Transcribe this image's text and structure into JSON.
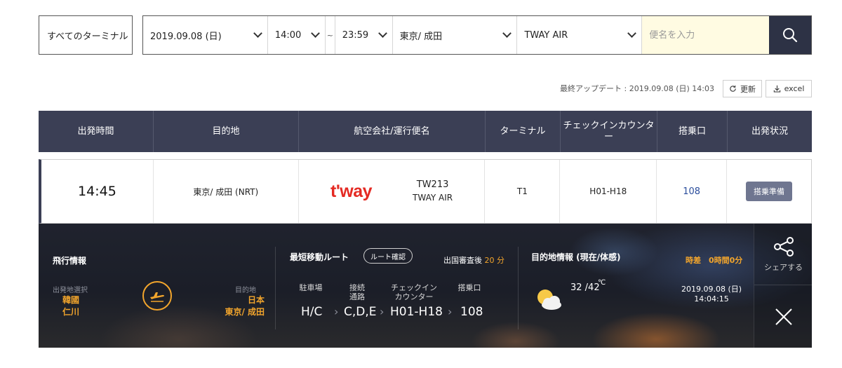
{
  "search": {
    "terminal": "すべてのターミナル",
    "date": "2019.09.08 (日)",
    "time_from": "14:00",
    "tilde": "~",
    "time_to": "23:59",
    "destination": "東京/ 成田",
    "airline": "TWAY AIR",
    "flight_placeholder": "便名を入力",
    "flight_value": ""
  },
  "update": {
    "text": "最終アップデート : 2019.09.08 (日) 14:03",
    "refresh_label": "更新",
    "excel_label": "excel"
  },
  "table": {
    "headers": [
      "出発時間",
      "目的地",
      "航空会社/運行便名",
      "ターミナル",
      "チェックインカウンター",
      "搭乗口",
      "出発状況"
    ],
    "row": {
      "time": "14:45",
      "destination": "東京/ 成田 (NRT)",
      "airline_logo": "t'way",
      "flight_no": "TW213",
      "airline": "TWAY AIR",
      "terminal": "T1",
      "counter": "H01-H18",
      "gate": "108",
      "status": "搭乗準備"
    }
  },
  "detail": {
    "flight_info": {
      "title": "飛行情報",
      "origin_label": "出発地選択",
      "origin_country": "韓國",
      "origin_city": "仁川",
      "dest_label": "目的地",
      "dest_country": "日本",
      "dest_city": "東京/ 成田"
    },
    "route": {
      "title": "最短移動ルート",
      "button": "ルート確認",
      "immigration_prefix": "出国審査後",
      "immigration_value": "20 分",
      "steps": [
        {
          "label": "駐車場",
          "value": "H/C"
        },
        {
          "label": "接続 通路",
          "value": "C,D,E"
        },
        {
          "label": "チェックイン カウンター",
          "value": "H01-H18"
        },
        {
          "label": "搭乗口",
          "value": "108"
        }
      ]
    },
    "weather": {
      "title": "目的地情報 (現在/体感)",
      "timediff": "時差　0時間0分",
      "temp": "32 /42",
      "unit": "℃",
      "date": "2019.09.08 (日)",
      "time": "14:04:15",
      "icon": "partly-cloudy-icon"
    },
    "share_label": "シェアする"
  },
  "colors": {
    "navy": "#3b3f55",
    "accent": "#f2a52c",
    "tway_red": "#e42a23",
    "search_button": "#2d3245",
    "input_bg": "#fffbe2"
  }
}
